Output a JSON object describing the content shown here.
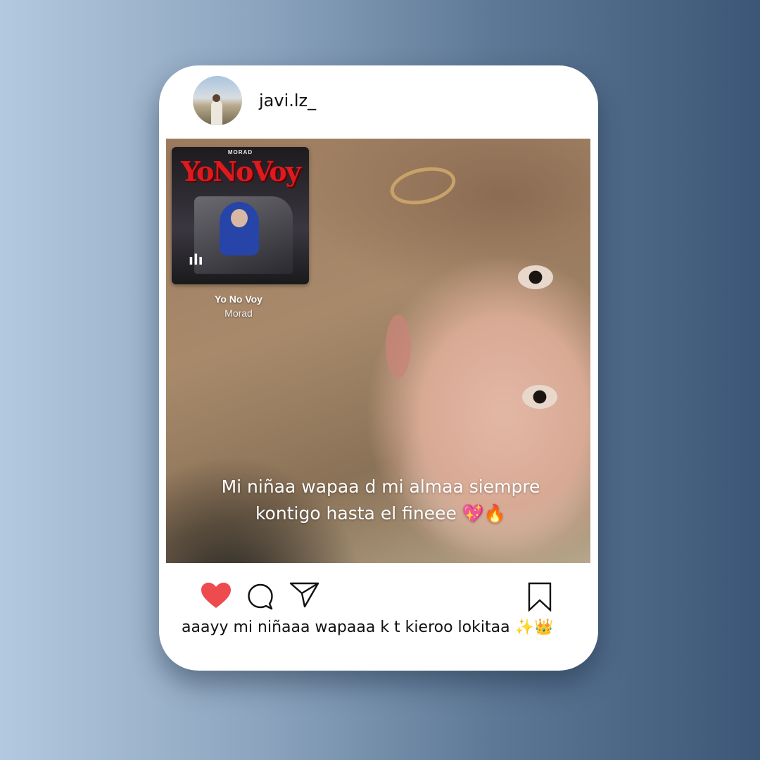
{
  "post": {
    "username": "javi.lz_",
    "overlay_caption": "Mi niñaa wapaa d mi almaa   siempre kontigo hasta el fineee 💖🔥",
    "caption": "aaayy mi niñaaa wapaaa k t kieroo lokitaa ✨👑",
    "liked": true
  },
  "music": {
    "album_label_top": "MORAD",
    "album_title": "YoNoVoy",
    "song_title": "Yo No Voy",
    "artist": "Morad",
    "play_glyph": "ılı"
  },
  "actions": {
    "heart_icon": "heart-icon",
    "comment_icon": "comment-icon",
    "share_icon": "share-icon",
    "bookmark_icon": "bookmark-icon"
  },
  "colors": {
    "heart": "#ee4b4f",
    "card_bg": "#ffffff"
  }
}
